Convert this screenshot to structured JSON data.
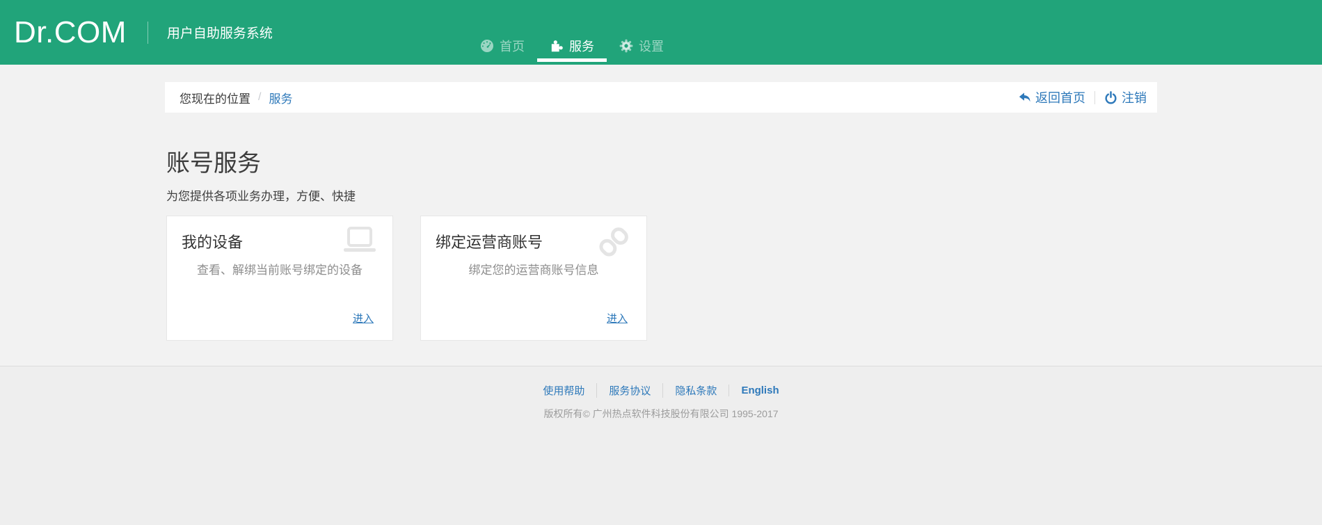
{
  "colors": {
    "brand_green": "#21a47a",
    "link_blue": "#2e79ba",
    "page_background": "#f2f2f2",
    "icon_gray": "#e4e4e4"
  },
  "header": {
    "brand": "Dr.COM",
    "subtitle": "用户自助服务系统",
    "tabs": [
      {
        "label": "首页",
        "icon": "dashboard-icon",
        "active": false
      },
      {
        "label": "服务",
        "icon": "puzzle-icon",
        "active": true
      },
      {
        "label": "设置",
        "icon": "gear-icon",
        "active": false
      }
    ]
  },
  "breadcrumb": {
    "prefix": "您现在的位置",
    "separator": "/",
    "current": "服务",
    "back_home": "返回首页",
    "back_home_icon": "reply-icon",
    "logout": "注销",
    "logout_icon": "power-icon"
  },
  "main": {
    "title": "账号服务",
    "subtitle": "为您提供各项业务办理，方便、快捷",
    "cards": [
      {
        "title": "我的设备",
        "icon": "laptop-icon",
        "description": "查看、解绑当前账号绑定的设备",
        "action": "进入"
      },
      {
        "title": "绑定运营商账号",
        "icon": "chain-link-icon",
        "description": "绑定您的运营商账号信息",
        "action": "进入"
      }
    ]
  },
  "footer": {
    "links": [
      "使用帮助",
      "服务协议",
      "隐私条款",
      "English"
    ],
    "copyright": "版权所有© 广州热点软件科技股份有限公司 1995-2017"
  }
}
